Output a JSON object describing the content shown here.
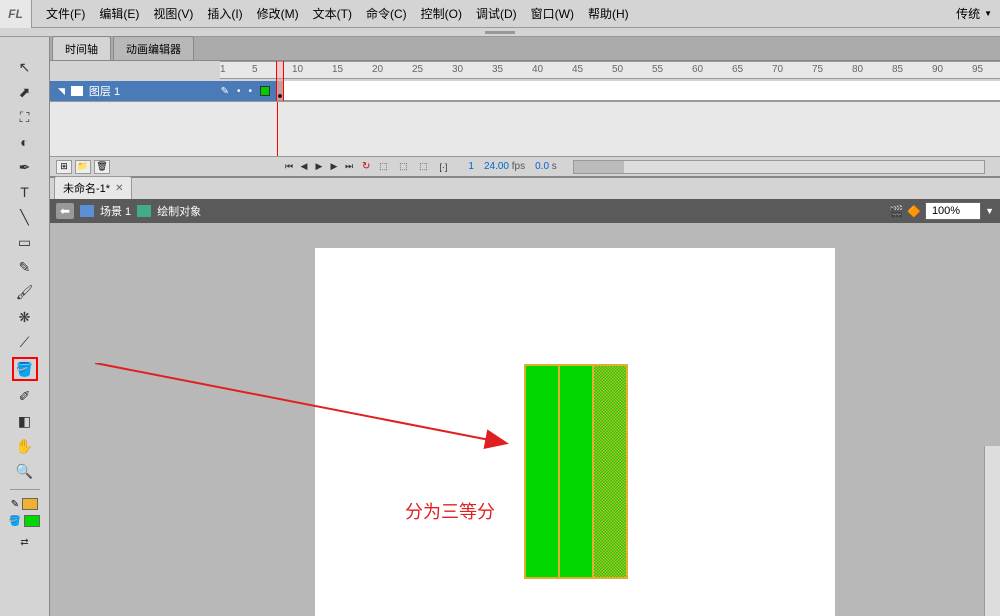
{
  "menu": {
    "items": [
      "文件(F)",
      "编辑(E)",
      "视图(V)",
      "插入(I)",
      "修改(M)",
      "文本(T)",
      "命令(C)",
      "控制(O)",
      "调试(D)",
      "窗口(W)",
      "帮助(H)"
    ],
    "workspace": "传统"
  },
  "tabs": {
    "timeline": "时间轴",
    "motion_editor": "动画编辑器"
  },
  "timeline": {
    "layer_name": "图层 1",
    "ruler_marks": [
      1,
      5,
      10,
      15,
      20,
      25,
      30,
      35,
      40,
      45,
      50,
      55,
      60,
      65,
      70,
      75,
      80,
      85,
      90,
      95
    ],
    "current_frame": "1",
    "fps_value": "24.00",
    "fps_label": "fps",
    "time_value": "0.0",
    "time_label": "s"
  },
  "document": {
    "tab_name": "未命名-1*"
  },
  "editbar": {
    "back_arrow": "⬅",
    "scene_label": "场景 1",
    "object_label": "绘制对象",
    "zoom_value": "100%"
  },
  "annotation": {
    "text": "分为三等分"
  },
  "tools": {
    "selection": "selection-tool",
    "subselection": "subselection-tool",
    "free_transform": "free-transform-tool",
    "lasso": "lasso-tool",
    "pen": "pen-tool",
    "text": "text-tool",
    "line": "line-tool",
    "rectangle": "rectangle-tool",
    "pencil": "pencil-tool",
    "brush": "brush-tool",
    "deco": "deco-tool",
    "bone": "bone-tool",
    "paint_bucket": "paint-bucket-tool",
    "eyedropper": "eyedropper-tool",
    "eraser": "eraser-tool",
    "hand": "hand-tool",
    "zoom": "zoom-tool"
  },
  "colors": {
    "stroke": "#f0b030",
    "fill": "#00d800"
  }
}
